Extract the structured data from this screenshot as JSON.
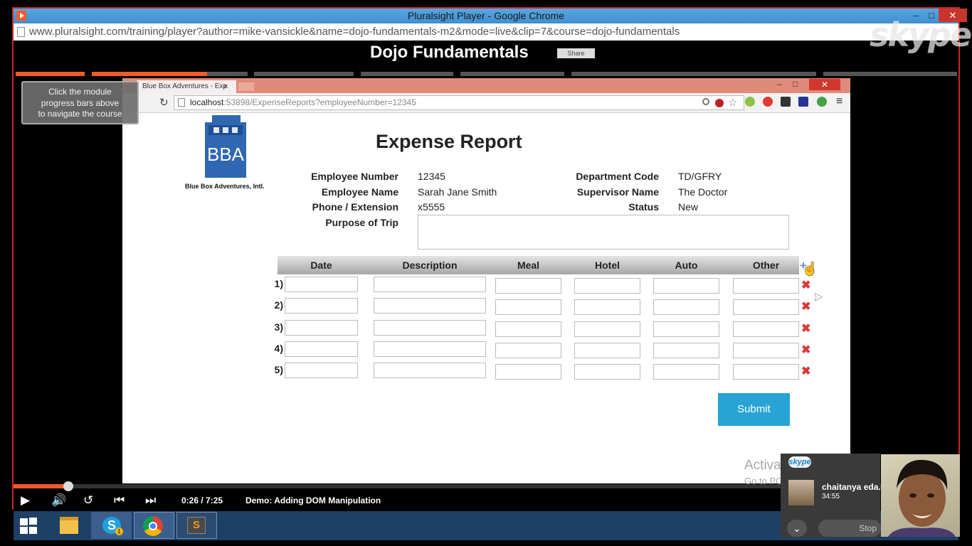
{
  "window": {
    "title": "Pluralsight Player - Google Chrome",
    "url": "www.pluralsight.com/training/player?author=mike-vansickle&name=dojo-fundamentals-m2&mode=live&clip=7&course=dojo-fundamentals",
    "minimize": "–",
    "maximize": "□",
    "close": "✕"
  },
  "watermark": "skype",
  "course": {
    "title": "Dojo Fundamentals",
    "share_label": "Share"
  },
  "tooltip": {
    "line1": "Click the module",
    "line2": "progress bars above",
    "line3": "to navigate the course"
  },
  "inner_browser": {
    "tab_title": "Blue Box Adventures - Exp",
    "tab_close": "×",
    "url_host": "localhost",
    "url_rest": ":53898/ExpenseReports?employeeNumber=12345",
    "reload": "↻",
    "menu": "≡",
    "min": "–",
    "max": "□",
    "close": "✕"
  },
  "logo": {
    "letters": "BBA",
    "caption": "Blue Box Adventures, Intl."
  },
  "report": {
    "title": "Expense Report",
    "fields_left": [
      {
        "label": "Employee Number",
        "value": "12345"
      },
      {
        "label": "Employee Name",
        "value": "Sarah Jane Smith"
      },
      {
        "label": "Phone / Extension",
        "value": "x5555"
      },
      {
        "label": "Purpose of Trip",
        "value": ""
      }
    ],
    "fields_right": [
      {
        "label": "Department Code",
        "value": "TD/GFRY"
      },
      {
        "label": "Supervisor Name",
        "value": "The Doctor"
      },
      {
        "label": "Status",
        "value": "New"
      }
    ],
    "columns": [
      "Date",
      "Description",
      "Meal",
      "Hotel",
      "Auto",
      "Other"
    ],
    "add_row": "+",
    "delete_icon": "✖",
    "rows": [
      {
        "num": "1)",
        "date": "",
        "description": "",
        "meal": "",
        "hotel": "",
        "auto": "",
        "other": ""
      },
      {
        "num": "2)",
        "date": "",
        "description": "",
        "meal": "",
        "hotel": "",
        "auto": "",
        "other": ""
      },
      {
        "num": "3)",
        "date": "",
        "description": "",
        "meal": "",
        "hotel": "",
        "auto": "",
        "other": ""
      },
      {
        "num": "4)",
        "date": "",
        "description": "",
        "meal": "",
        "hotel": "",
        "auto": "",
        "other": ""
      },
      {
        "num": "5)",
        "date": "",
        "description": "",
        "meal": "",
        "hotel": "",
        "auto": "",
        "other": ""
      }
    ],
    "submit": "Submit"
  },
  "activate_windows": {
    "title": "Activate Windows",
    "subtitle": "Go to PC settings to activate W"
  },
  "player": {
    "progress": 0.058,
    "timecode": "0:26 / 7:25",
    "clip_title": "Demo: Adding DOM Manipulation",
    "play": "▶",
    "volume": "🔊",
    "replay": "↺",
    "prev": "⏮",
    "next": "⏭"
  },
  "taskbar": {
    "items": [
      "file-explorer",
      "skype",
      "chrome",
      "sublime-text"
    ],
    "skype_badge": "1",
    "sublime_letter": "S"
  },
  "skype_call": {
    "logo": "skype",
    "caller": "chaitanya eda...",
    "duration": "34:55",
    "expand": "⌄",
    "stop": "Stop"
  },
  "colors": {
    "accent": "#f15b2a",
    "submit": "#27a4d3",
    "delete": "#d63a3a",
    "taskbar": "#1e3f66",
    "window_border": "#c62828"
  }
}
